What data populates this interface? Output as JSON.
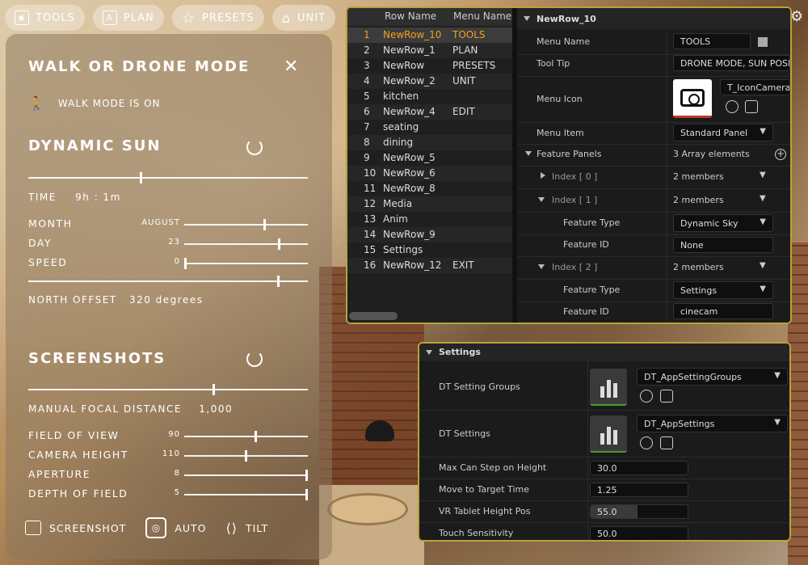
{
  "toolbar": {
    "buttons": [
      {
        "label": "TOOLS",
        "icon": "camera-icon"
      },
      {
        "label": "PLAN",
        "icon": "plan-icon"
      },
      {
        "label": "PRESETS",
        "icon": "star-icon"
      },
      {
        "label": "UNIT",
        "icon": "unit-icon"
      }
    ],
    "settings_icon": "⚙"
  },
  "left_panel": {
    "title": "WALK OR DRONE MODE",
    "close": "✕",
    "walk_status": "WALK MODE IS ON",
    "dynamic_sun": {
      "title": "DYNAMIC SUN",
      "time_slider": 0.4,
      "time_label": "TIME",
      "time_value": "9h : 1m",
      "rows": [
        {
          "label": "MONTH",
          "value": "AUGUST",
          "level": 0.64
        },
        {
          "label": "DAY",
          "value": "23",
          "level": 0.76
        },
        {
          "label": "SPEED",
          "value": "0",
          "level": 0.0
        }
      ],
      "north_slider": 0.89,
      "north_label": "NORTH OFFSET",
      "north_value": "320 degrees"
    },
    "screenshots": {
      "title": "SCREENSHOTS",
      "focal_slider": 0.66,
      "focal_label": "MANUAL FOCAL DISTANCE",
      "focal_value": "1,000",
      "rows": [
        {
          "label": "FIELD OF VIEW",
          "value": "90",
          "level": 0.57
        },
        {
          "label": "CAMERA HEIGHT",
          "value": "110",
          "level": 0.49
        },
        {
          "label": "APERTURE",
          "value": "8",
          "level": 1.0
        },
        {
          "label": "DEPTH OF FIELD",
          "value": "5",
          "level": 1.0
        }
      ]
    },
    "actions": [
      {
        "label": "SCREENSHOT"
      },
      {
        "label": "AUTO"
      },
      {
        "label": "TILT"
      }
    ]
  },
  "data_table": {
    "columns": [
      "Row Name",
      "Menu Name"
    ],
    "rows": [
      {
        "n": "1",
        "name": "NewRow_10",
        "menu": "TOOLS"
      },
      {
        "n": "2",
        "name": "NewRow_1",
        "menu": "PLAN"
      },
      {
        "n": "3",
        "name": "NewRow",
        "menu": "PRESETS"
      },
      {
        "n": "4",
        "name": "NewRow_2",
        "menu": "UNIT"
      },
      {
        "n": "5",
        "name": "kitchen",
        "menu": ""
      },
      {
        "n": "6",
        "name": "NewRow_4",
        "menu": "EDIT"
      },
      {
        "n": "7",
        "name": "seating",
        "menu": ""
      },
      {
        "n": "8",
        "name": "dining",
        "menu": ""
      },
      {
        "n": "9",
        "name": "NewRow_5",
        "menu": ""
      },
      {
        "n": "10",
        "name": "NewRow_6",
        "menu": ""
      },
      {
        "n": "11",
        "name": "NewRow_8",
        "menu": ""
      },
      {
        "n": "12",
        "name": "Media",
        "menu": ""
      },
      {
        "n": "13",
        "name": "Anim",
        "menu": ""
      },
      {
        "n": "14",
        "name": "NewRow_9",
        "menu": ""
      },
      {
        "n": "15",
        "name": "Settings",
        "menu": ""
      },
      {
        "n": "16",
        "name": "NewRow_12",
        "menu": "EXIT"
      }
    ],
    "selected_index": 0
  },
  "details": {
    "header": "NewRow_10",
    "menu_name_label": "Menu Name",
    "menu_name_value": "TOOLS",
    "tooltip_label": "Tool Tip",
    "tooltip_value": "DRONE MODE, SUN POSITI",
    "menu_icon_label": "Menu Icon",
    "menu_icon_value": "T_IconCamera",
    "menu_item_label": "Menu Item",
    "menu_item_value": "Standard Panel",
    "feature_panels_label": "Feature Panels",
    "feature_panels_value": "3 Array elements",
    "index0_label": "Index [ 0 ]",
    "index0_value": "2 members",
    "index1_label": "Index [ 1 ]",
    "index1_value": "2 members",
    "index1_type_label": "Feature Type",
    "index1_type_value": "Dynamic Sky",
    "index1_id_label": "Feature ID",
    "index1_id_value": "None",
    "index2_label": "Index [ 2 ]",
    "index2_value": "2 members",
    "index2_type_label": "Feature Type",
    "index2_type_value": "Settings",
    "index2_id_label": "Feature ID",
    "index2_id_value": "cinecam"
  },
  "settings": {
    "header": "Settings",
    "groups_label": "DT Setting Groups",
    "groups_value": "DT_AppSettingGroups",
    "settings_label": "DT Settings",
    "settings_value": "DT_AppSettings",
    "rows": [
      {
        "label": "Max Can Step on Height",
        "value": "30.0",
        "level": 0.0
      },
      {
        "label": "Move to Target Time",
        "value": "1.25",
        "level": 0.0
      },
      {
        "label": "VR Tablet Height Pos",
        "value": "55.0",
        "level": 0.48
      },
      {
        "label": "Touch Sensitivity",
        "value": "50.0",
        "level": 0.0
      }
    ]
  }
}
